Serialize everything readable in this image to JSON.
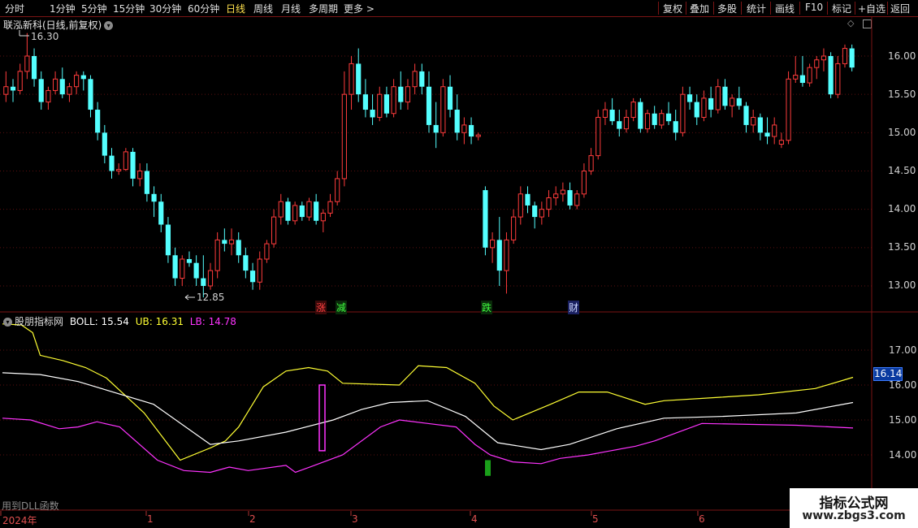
{
  "toolbar": {
    "tabs": [
      "分时",
      "1分钟",
      "5分钟",
      "15分钟",
      "30分钟",
      "60分钟",
      "日线",
      "周线",
      "月线",
      "多周期",
      "更多 >"
    ],
    "active": "日线",
    "right": [
      "复权",
      "叠加",
      "多股",
      "统计",
      "画线",
      "F10",
      "标记",
      "+自选",
      "返回"
    ]
  },
  "main": {
    "title": "联泓新科(日线,前复权)",
    "high_label": "16.30",
    "low_label": "12.85",
    "y_ticks": [
      "16.00",
      "15.50",
      "15.00",
      "14.50",
      "14.00",
      "13.50",
      "13.00"
    ],
    "badges": [
      "涨",
      "减",
      "跌",
      "财"
    ],
    "colors": {
      "up": "#ff3c3c",
      "down": "#54ffff"
    }
  },
  "indicator": {
    "name": "股朋指标网",
    "boll_label": "BOLL: 15.54",
    "ub_label": "UB: 16.31",
    "lb_label": "LB: 14.78",
    "y_ticks": [
      "17.00",
      "16.00",
      "15.00",
      "14.00"
    ],
    "current": "16.14",
    "colors": {
      "boll": "#ffffff",
      "ub": "#ffff33",
      "lb": "#ff33ff"
    }
  },
  "xaxis": {
    "labels": [
      "2024年",
      "1",
      "2",
      "3",
      "4",
      "5",
      "6"
    ]
  },
  "footer": {
    "dll": "用到DLL函数"
  },
  "watermark": {
    "line1": "指标公式网",
    "line2": "www.zbgs3.com"
  },
  "chart_data": {
    "type": "candlestick",
    "price_range": [
      12.6,
      16.4
    ],
    "candles": [
      [
        15.5,
        15.8,
        15.4,
        15.6
      ],
      [
        15.6,
        15.7,
        15.4,
        15.55
      ],
      [
        15.55,
        15.9,
        15.5,
        15.8
      ],
      [
        15.8,
        16.3,
        15.7,
        16.0
      ],
      [
        16.0,
        16.1,
        15.6,
        15.7
      ],
      [
        15.7,
        15.8,
        15.3,
        15.4
      ],
      [
        15.4,
        15.6,
        15.3,
        15.55
      ],
      [
        15.55,
        15.8,
        15.5,
        15.7
      ],
      [
        15.7,
        15.85,
        15.45,
        15.5
      ],
      [
        15.5,
        15.65,
        15.4,
        15.6
      ],
      [
        15.6,
        15.8,
        15.5,
        15.75
      ],
      [
        15.75,
        15.8,
        15.55,
        15.7
      ],
      [
        15.7,
        15.75,
        15.2,
        15.3
      ],
      [
        15.3,
        15.4,
        14.9,
        15.0
      ],
      [
        15.0,
        15.1,
        14.6,
        14.7
      ],
      [
        14.7,
        14.8,
        14.4,
        14.5
      ],
      [
        14.5,
        14.6,
        14.45,
        14.52
      ],
      [
        14.52,
        14.8,
        14.5,
        14.75
      ],
      [
        14.75,
        14.8,
        14.3,
        14.4
      ],
      [
        14.4,
        14.6,
        14.3,
        14.5
      ],
      [
        14.5,
        14.6,
        14.1,
        14.2
      ],
      [
        14.2,
        14.3,
        13.9,
        14.1
      ],
      [
        14.1,
        14.2,
        13.7,
        13.8
      ],
      [
        13.8,
        13.9,
        13.3,
        13.4
      ],
      [
        13.4,
        13.5,
        13.0,
        13.1
      ],
      [
        13.1,
        13.4,
        13.0,
        13.35
      ],
      [
        13.35,
        13.45,
        13.25,
        13.3
      ],
      [
        13.3,
        13.4,
        13.0,
        13.1
      ],
      [
        13.1,
        13.4,
        12.85,
        13.0
      ],
      [
        13.0,
        13.3,
        12.95,
        13.2
      ],
      [
        13.2,
        13.7,
        13.1,
        13.6
      ],
      [
        13.6,
        13.75,
        13.45,
        13.55
      ],
      [
        13.55,
        13.75,
        13.4,
        13.6
      ],
      [
        13.6,
        13.7,
        13.3,
        13.4
      ],
      [
        13.4,
        13.5,
        13.1,
        13.2
      ],
      [
        13.2,
        13.3,
        12.95,
        13.05
      ],
      [
        13.05,
        13.45,
        12.95,
        13.35
      ],
      [
        13.35,
        13.6,
        13.3,
        13.55
      ],
      [
        13.55,
        14.0,
        13.5,
        13.9
      ],
      [
        13.9,
        14.2,
        13.8,
        14.1
      ],
      [
        14.1,
        14.15,
        13.8,
        13.85
      ],
      [
        13.85,
        14.1,
        13.8,
        14.05
      ],
      [
        14.05,
        14.1,
        13.85,
        13.9
      ],
      [
        13.9,
        14.15,
        13.85,
        14.1
      ],
      [
        14.1,
        14.2,
        13.8,
        13.85
      ],
      [
        13.85,
        14.0,
        13.7,
        13.95
      ],
      [
        13.95,
        14.2,
        13.9,
        14.1
      ],
      [
        14.1,
        14.5,
        14.05,
        14.4
      ],
      [
        14.4,
        15.8,
        14.3,
        15.5
      ],
      [
        15.5,
        16.0,
        15.3,
        15.9
      ],
      [
        15.9,
        16.1,
        15.4,
        15.5
      ],
      [
        15.5,
        15.7,
        15.2,
        15.3
      ],
      [
        15.3,
        15.5,
        15.1,
        15.2
      ],
      [
        15.2,
        15.6,
        15.15,
        15.5
      ],
      [
        15.5,
        15.6,
        15.2,
        15.25
      ],
      [
        15.25,
        15.7,
        15.2,
        15.6
      ],
      [
        15.6,
        15.8,
        15.3,
        15.4
      ],
      [
        15.4,
        15.7,
        15.3,
        15.6
      ],
      [
        15.6,
        15.9,
        15.5,
        15.8
      ],
      [
        15.8,
        15.9,
        15.5,
        15.6
      ],
      [
        15.6,
        15.8,
        15.0,
        15.1
      ],
      [
        15.1,
        15.4,
        14.8,
        15.0
      ],
      [
        15.0,
        15.7,
        14.95,
        15.6
      ],
      [
        15.6,
        15.75,
        15.2,
        15.3
      ],
      [
        15.3,
        15.5,
        14.9,
        15.0
      ],
      [
        15.0,
        15.2,
        14.85,
        15.1
      ],
      [
        15.1,
        15.2,
        14.85,
        14.95
      ],
      [
        14.95,
        15.0,
        14.9,
        14.97
      ],
      [
        14.25,
        14.3,
        13.4,
        13.5
      ],
      [
        13.5,
        13.7,
        13.3,
        13.6
      ],
      [
        13.6,
        13.9,
        13.0,
        13.2
      ],
      [
        13.2,
        13.7,
        12.9,
        13.6
      ],
      [
        13.6,
        14.0,
        13.55,
        13.9
      ],
      [
        13.9,
        14.3,
        13.8,
        14.2
      ],
      [
        14.2,
        14.3,
        13.95,
        14.05
      ],
      [
        14.05,
        14.1,
        13.75,
        13.9
      ],
      [
        13.9,
        14.1,
        13.8,
        14.0
      ],
      [
        14.0,
        14.25,
        13.9,
        14.15
      ],
      [
        14.15,
        14.3,
        14.05,
        14.2
      ],
      [
        14.2,
        14.35,
        14.1,
        14.25
      ],
      [
        14.25,
        14.35,
        14.0,
        14.05
      ],
      [
        14.05,
        14.25,
        14.0,
        14.2
      ],
      [
        14.2,
        14.6,
        14.15,
        14.5
      ],
      [
        14.5,
        14.8,
        14.45,
        14.7
      ],
      [
        14.7,
        15.3,
        14.65,
        15.2
      ],
      [
        15.2,
        15.4,
        15.1,
        15.3
      ],
      [
        15.3,
        15.45,
        15.1,
        15.15
      ],
      [
        15.15,
        15.3,
        14.95,
        15.05
      ],
      [
        15.05,
        15.3,
        15.0,
        15.2
      ],
      [
        15.2,
        15.45,
        15.15,
        15.4
      ],
      [
        15.4,
        15.45,
        15.0,
        15.05
      ],
      [
        15.05,
        15.3,
        15.0,
        15.25
      ],
      [
        15.25,
        15.35,
        15.05,
        15.1
      ],
      [
        15.1,
        15.3,
        15.05,
        15.25
      ],
      [
        15.25,
        15.4,
        15.1,
        15.15
      ],
      [
        15.15,
        15.3,
        14.9,
        15.0
      ],
      [
        15.0,
        15.6,
        14.95,
        15.5
      ],
      [
        15.5,
        15.6,
        15.3,
        15.4
      ],
      [
        15.4,
        15.5,
        15.1,
        15.2
      ],
      [
        15.2,
        15.55,
        15.15,
        15.45
      ],
      [
        15.45,
        15.6,
        15.2,
        15.3
      ],
      [
        15.3,
        15.7,
        15.25,
        15.6
      ],
      [
        15.6,
        15.7,
        15.3,
        15.35
      ],
      [
        15.35,
        15.5,
        15.2,
        15.45
      ],
      [
        15.45,
        15.6,
        15.3,
        15.35
      ],
      [
        15.35,
        15.4,
        15.0,
        15.1
      ],
      [
        15.1,
        15.3,
        15.0,
        15.2
      ],
      [
        15.2,
        15.25,
        14.9,
        15.0
      ],
      [
        15.0,
        15.2,
        14.85,
        14.95
      ],
      [
        14.95,
        15.2,
        14.85,
        15.1
      ],
      [
        14.85,
        15.0,
        14.8,
        14.9
      ],
      [
        14.9,
        15.8,
        14.85,
        15.7
      ],
      [
        15.7,
        16.0,
        15.65,
        15.75
      ],
      [
        15.75,
        16.0,
        15.6,
        15.65
      ],
      [
        15.65,
        15.9,
        15.6,
        15.85
      ],
      [
        15.85,
        16.0,
        15.7,
        15.95
      ],
      [
        15.95,
        16.1,
        15.8,
        16.0
      ],
      [
        16.0,
        16.05,
        15.45,
        15.5
      ],
      [
        15.5,
        16.0,
        15.45,
        15.9
      ],
      [
        15.9,
        16.15,
        15.85,
        16.1
      ],
      [
        16.1,
        16.15,
        15.8,
        15.85
      ]
    ],
    "boll_range": [
      13.4,
      17.9
    ],
    "boll": {
      "ub": [
        [
          0,
          17.75
        ],
        [
          10,
          17.72
        ],
        [
          16,
          17.5
        ],
        [
          20,
          16.85
        ],
        [
          32,
          16.7
        ],
        [
          44,
          16.5
        ],
        [
          55,
          16.2
        ],
        [
          75,
          15.2
        ],
        [
          94,
          13.85
        ],
        [
          110,
          14.2
        ],
        [
          118,
          14.4
        ],
        [
          125,
          14.8
        ],
        [
          138,
          15.95
        ],
        [
          150,
          16.4
        ],
        [
          162,
          16.5
        ],
        [
          172,
          16.4
        ],
        [
          180,
          16.05
        ],
        [
          210,
          16.0
        ],
        [
          220,
          16.55
        ],
        [
          235,
          16.5
        ],
        [
          250,
          16.05
        ],
        [
          260,
          15.4
        ],
        [
          270,
          15.0
        ],
        [
          290,
          15.45
        ],
        [
          305,
          15.8
        ],
        [
          320,
          15.8
        ],
        [
          340,
          15.45
        ],
        [
          350,
          15.55
        ],
        [
          380,
          15.65
        ],
        [
          400,
          15.72
        ],
        [
          430,
          15.9
        ],
        [
          450,
          16.22
        ]
      ],
      "mid": [
        [
          0,
          16.35
        ],
        [
          20,
          16.3
        ],
        [
          40,
          16.1
        ],
        [
          80,
          15.45
        ],
        [
          110,
          14.3
        ],
        [
          125,
          14.4
        ],
        [
          150,
          14.65
        ],
        [
          175,
          15.0
        ],
        [
          190,
          15.3
        ],
        [
          205,
          15.5
        ],
        [
          225,
          15.55
        ],
        [
          245,
          15.1
        ],
        [
          262,
          14.35
        ],
        [
          285,
          14.15
        ],
        [
          300,
          14.3
        ],
        [
          325,
          14.75
        ],
        [
          350,
          15.05
        ],
        [
          380,
          15.1
        ],
        [
          420,
          15.2
        ],
        [
          450,
          15.5
        ]
      ],
      "lb": [
        [
          0,
          15.05
        ],
        [
          15,
          15.0
        ],
        [
          30,
          14.75
        ],
        [
          40,
          14.8
        ],
        [
          50,
          14.95
        ],
        [
          62,
          14.8
        ],
        [
          82,
          13.85
        ],
        [
          96,
          13.55
        ],
        [
          110,
          13.5
        ],
        [
          120,
          13.65
        ],
        [
          130,
          13.55
        ],
        [
          150,
          13.7
        ],
        [
          155,
          13.5
        ],
        [
          165,
          13.7
        ],
        [
          180,
          14.0
        ],
        [
          200,
          14.8
        ],
        [
          210,
          15.0
        ],
        [
          225,
          14.9
        ],
        [
          240,
          14.8
        ],
        [
          250,
          14.3
        ],
        [
          258,
          14.0
        ],
        [
          270,
          13.8
        ],
        [
          285,
          13.75
        ],
        [
          295,
          13.9
        ],
        [
          310,
          14.0
        ],
        [
          320,
          14.1
        ],
        [
          335,
          14.25
        ],
        [
          345,
          14.4
        ],
        [
          360,
          14.7
        ],
        [
          370,
          14.9
        ],
        [
          420,
          14.85
        ],
        [
          450,
          14.77
        ]
      ]
    },
    "markers": [
      {
        "type": "box",
        "x": 396,
        "top": 16.0,
        "bottom": 14.12,
        "color": "#ff33ff"
      },
      {
        "type": "bar",
        "x": 600,
        "top": 13.85,
        "bottom": 13.4,
        "color": "#1aa01a"
      }
    ]
  }
}
